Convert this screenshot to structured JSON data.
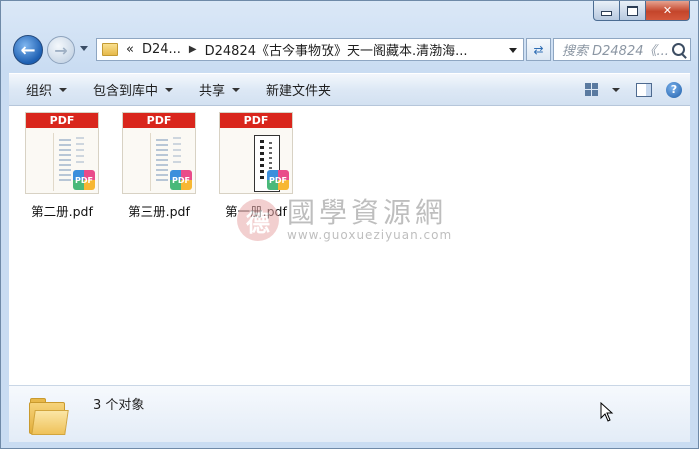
{
  "window": {
    "caption_buttons": [
      "minimize",
      "maximize",
      "close"
    ],
    "close_glyph": "✕"
  },
  "navigation": {
    "back_glyph": "←",
    "forward_glyph": "→",
    "breadcrumb_chevron": "«",
    "breadcrumb": [
      "D24...",
      "D24824《古今事物攷》天一阁藏本.清渤海..."
    ],
    "search_placeholder": "搜索 D24824《..."
  },
  "toolbar": {
    "organize": "组织",
    "include_in_library": "包含到库中",
    "share": "共享",
    "new_folder": "新建文件夹",
    "help_glyph": "?"
  },
  "files": [
    {
      "name": "第二册.pdf",
      "badge": "PDF",
      "header": "PDF"
    },
    {
      "name": "第三册.pdf",
      "badge": "PDF",
      "header": "PDF"
    },
    {
      "name": "第一册.pdf",
      "badge": "PDF",
      "header": "PDF"
    }
  ],
  "watermark": {
    "seal": "德",
    "site_name": "國學資源網",
    "url": "www.guoxueziyuan.com"
  },
  "status": {
    "item_count": "3 个对象"
  },
  "colors": {
    "pdf_red": "#d9261c",
    "chrome_blue": "#c9dcf2",
    "accent_blue": "#1d5fb2"
  }
}
